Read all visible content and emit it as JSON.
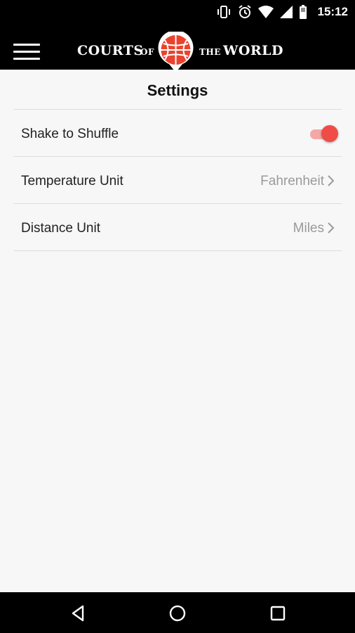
{
  "status_bar": {
    "time": "15:12",
    "icons": [
      "vibrate-icon",
      "alarm-icon",
      "wifi-icon",
      "cell-signal-icon",
      "battery-icon"
    ]
  },
  "app_bar": {
    "brand_left": "COURTS",
    "brand_of": "OF",
    "brand_the": "THE",
    "brand_right": "WORLD",
    "logo_icon": "basketball-globe-icon",
    "menu_icon": "hamburger-menu-icon",
    "logo_color": "#e9432f"
  },
  "page": {
    "title": "Settings"
  },
  "settings": {
    "shake": {
      "label": "Shake to Shuffle",
      "enabled": true
    },
    "temperature": {
      "label": "Temperature Unit",
      "value": "Fahrenheit"
    },
    "distance": {
      "label": "Distance Unit",
      "value": "Miles"
    }
  },
  "colors": {
    "accent": "#ef4b47",
    "accent_track": "#f4a8a5",
    "muted_text": "#9a9a9a",
    "divider": "#dcdcdc"
  },
  "nav_bar": {
    "icons": [
      "back-icon",
      "home-icon",
      "recents-icon"
    ]
  }
}
